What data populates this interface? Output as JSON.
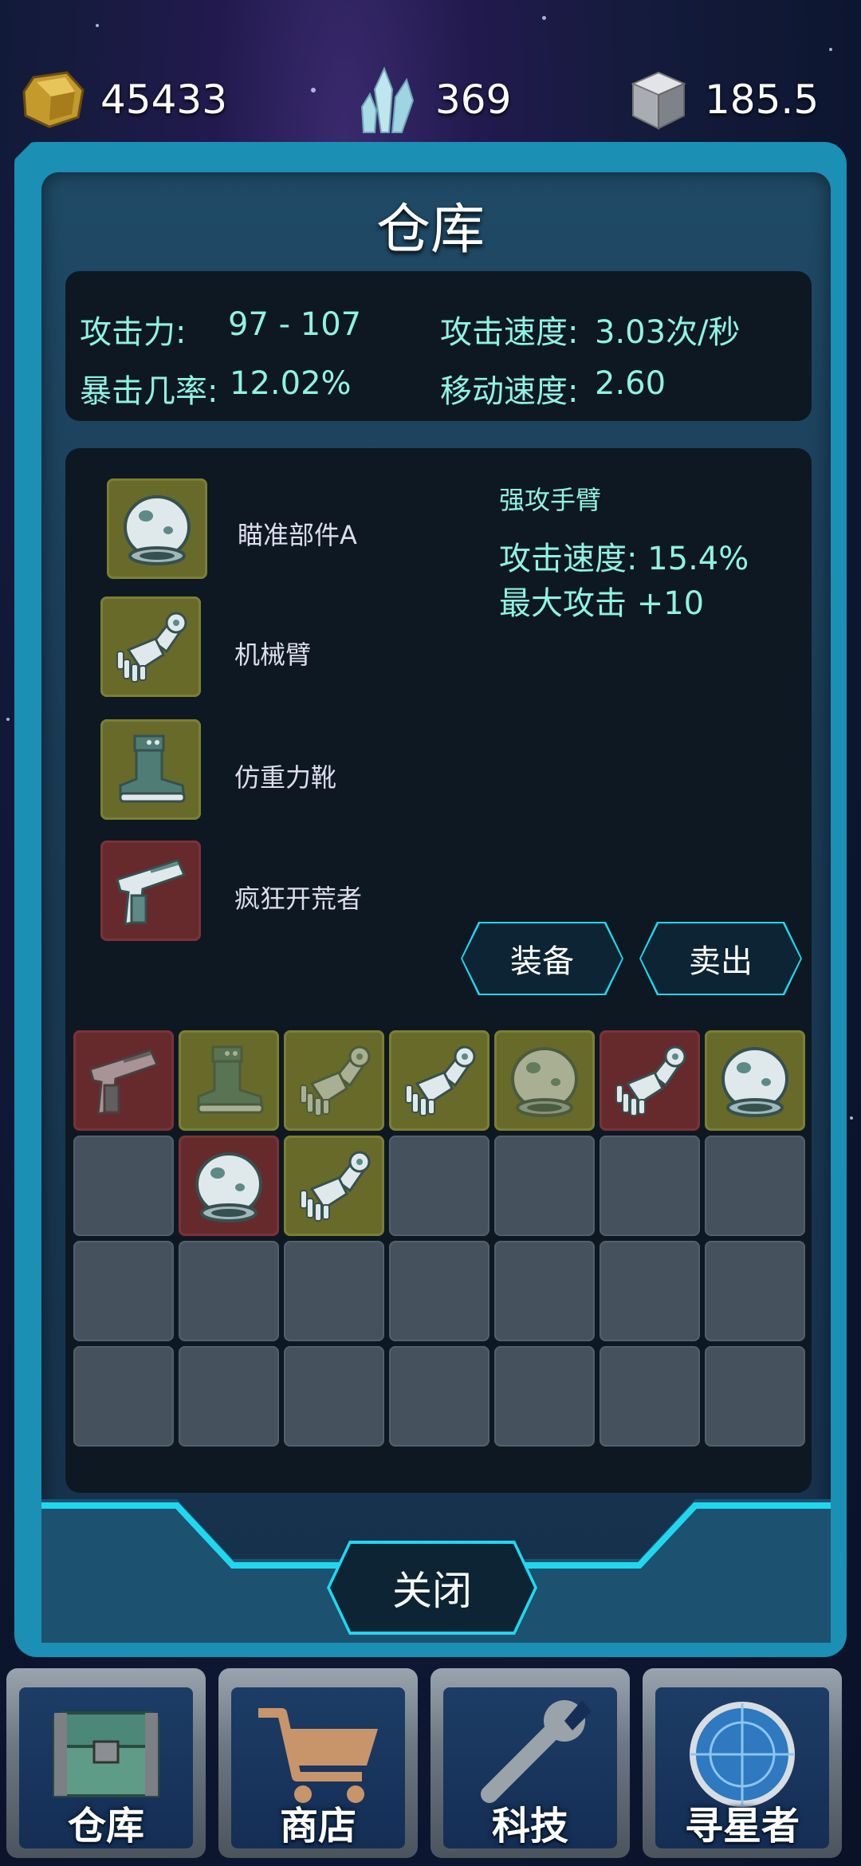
{
  "currencies": {
    "gold": {
      "icon": "gold-nugget-icon",
      "value": "45433"
    },
    "crystal": {
      "icon": "crystal-icon",
      "value": "369"
    },
    "metal": {
      "icon": "metal-cube-icon",
      "value": "185.5"
    }
  },
  "panel": {
    "title": "仓库",
    "stats": {
      "attack_label": "攻击力:",
      "attack_value": "97 - 107",
      "attack_speed_label": "攻击速度:",
      "attack_speed_value": "3.03次/秒",
      "crit_label": "暴击几率:",
      "crit_value": "12.02%",
      "move_speed_label": "移动速度:",
      "move_speed_value": "2.60"
    },
    "equipped": [
      {
        "name": "瞄准部件A",
        "icon": "helmet-icon",
        "rarity": "olive"
      },
      {
        "name": "机械臂",
        "icon": "robot-arm-icon",
        "rarity": "olive"
      },
      {
        "name": "仿重力靴",
        "icon": "boot-icon",
        "rarity": "olive"
      },
      {
        "name": "疯狂开荒者",
        "icon": "blaster-icon",
        "rarity": "maroon"
      }
    ],
    "detail": {
      "title": "强攻手臂",
      "line1": "攻击速度: 15.4%",
      "line2": "最大攻击 +10"
    },
    "equip_button": "装备",
    "sell_button": "卖出",
    "inventory": [
      {
        "icon": "blaster-icon",
        "rarity": "maroon",
        "dim": true
      },
      {
        "icon": "boot-icon",
        "rarity": "olive",
        "dim": true
      },
      {
        "icon": "robot-arm-icon",
        "rarity": "olive",
        "dim": true
      },
      {
        "icon": "robot-arm-icon",
        "rarity": "olive",
        "dim": false
      },
      {
        "icon": "helmet-icon",
        "rarity": "olive",
        "dim": true
      },
      {
        "icon": "robot-arm-icon",
        "rarity": "maroon",
        "dim": false
      },
      {
        "icon": "helmet-icon",
        "rarity": "olive",
        "dim": false
      },
      {
        "icon": "",
        "rarity": "grey"
      },
      {
        "icon": "helmet-icon",
        "rarity": "maroon",
        "dim": false
      },
      {
        "icon": "robot-arm-icon",
        "rarity": "olive",
        "dim": false
      },
      {
        "icon": "",
        "rarity": "grey"
      },
      {
        "icon": "",
        "rarity": "grey"
      },
      {
        "icon": "",
        "rarity": "grey"
      },
      {
        "icon": "",
        "rarity": "grey"
      },
      {
        "icon": "",
        "rarity": "grey"
      },
      {
        "icon": "",
        "rarity": "grey"
      },
      {
        "icon": "",
        "rarity": "grey"
      },
      {
        "icon": "",
        "rarity": "grey"
      },
      {
        "icon": "",
        "rarity": "grey"
      },
      {
        "icon": "",
        "rarity": "grey"
      },
      {
        "icon": "",
        "rarity": "grey"
      },
      {
        "icon": "",
        "rarity": "grey"
      },
      {
        "icon": "",
        "rarity": "grey"
      },
      {
        "icon": "",
        "rarity": "grey"
      },
      {
        "icon": "",
        "rarity": "grey"
      },
      {
        "icon": "",
        "rarity": "grey"
      },
      {
        "icon": "",
        "rarity": "grey"
      },
      {
        "icon": "",
        "rarity": "grey"
      }
    ],
    "close_button": "关闭"
  },
  "nav": [
    {
      "label": "仓库",
      "icon": "chest-icon"
    },
    {
      "label": "商店",
      "icon": "cart-icon"
    },
    {
      "label": "科技",
      "icon": "wrench-icon"
    },
    {
      "label": "寻星者",
      "icon": "radar-icon"
    }
  ],
  "colors": {
    "accent_cyan": "#1fd8ef",
    "stat_text": "#8ff3e2",
    "olive_slot": "#676a28",
    "maroon_slot": "#662a2d",
    "empty_slot": "#45525e"
  }
}
